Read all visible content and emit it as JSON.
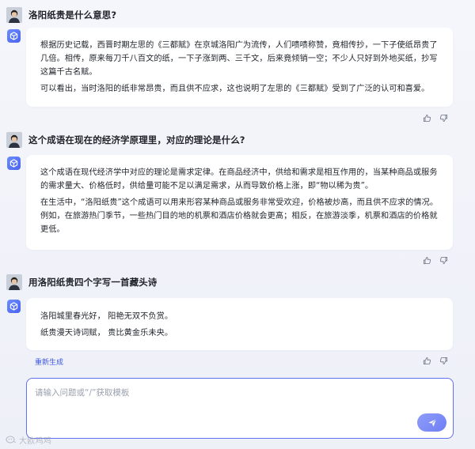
{
  "conversation": [
    {
      "question": "洛阳纸贵是什么意思?",
      "answer": [
        "根据历史记载，西晋时期左思的《三都赋》在京城洛阳广为流传，人们啧啧称赞，竟相传抄，一下子使纸昂贵了几倍。相传，原来每刀千八百文的纸，一下子涨到两、三千文，后来竟倾销一空；不少人只好到外地买纸，抄写这篇千古名赋。",
        "可以看出，当时洛阳的纸非常昂贵，而且供不应求，这也说明了左思的《三都赋》受到了广泛的认可和喜爱。"
      ]
    },
    {
      "question": "这个成语在现在的经济学原理里，对应的理论是什么?",
      "answer": [
        "这个成语在现代经济学中对应的理论是需求定律。在商品经济中，供给和需求是相互作用的，当某种商品或服务的需求量大、价格低时，供给量可能不足以满足需求，从而导致价格上涨，即“物以稀为贵”。",
        "在生活中，“洛阳纸贵”这个成语可以用来形容某种商品或服务非常受欢迎，价格被炒高，而且供不应求的情况。例如，在旅游热门季节，一些热门目的地的机票和酒店价格就会更高；相反，在旅游淡季，机票和酒店的价格就更低。"
      ]
    },
    {
      "question": "用洛阳纸贵四个字写一首藏头诗",
      "answer": [
        "洛阳城里春光好，  阳艳无双不负赏。",
        "纸贵漫天诗词赋，  贵比黄金乐未央。"
      ]
    }
  ],
  "regenerate_label": "重新生成",
  "input": {
    "placeholder": "请输入问题或“/”获取模板",
    "value": ""
  },
  "watermark_text": "大欧鸡鸡",
  "icons": {
    "bot": "bot-cube-icon",
    "like": "thumbs-up-icon",
    "dislike": "thumbs-down-icon",
    "send": "send-icon"
  },
  "colors": {
    "accent": "#4a63f0",
    "send_button": "#7b89f5",
    "background": "#f3f4f9",
    "card": "#ffffff"
  }
}
